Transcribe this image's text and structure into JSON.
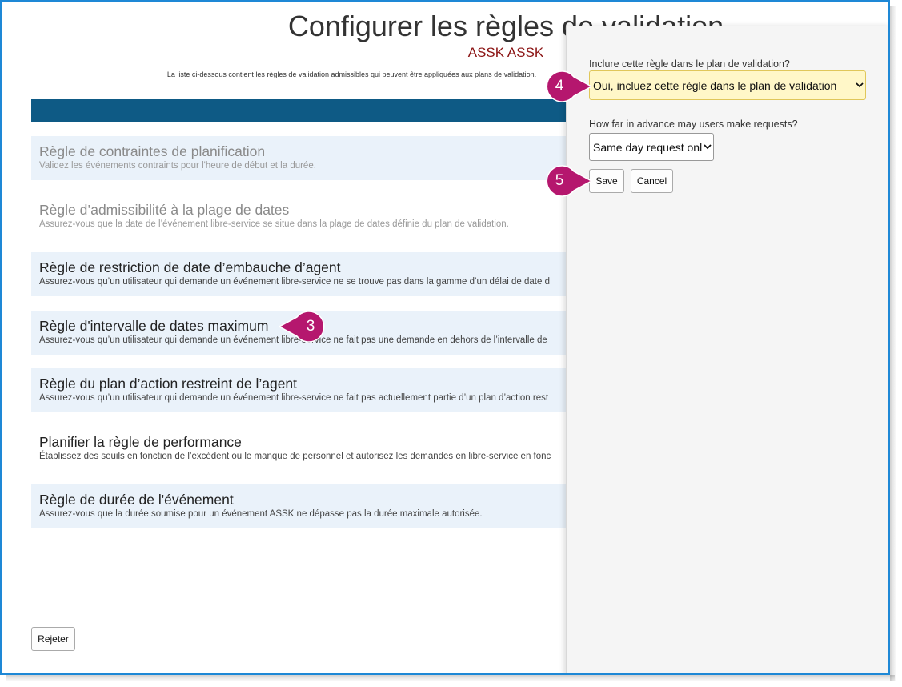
{
  "page": {
    "title": "Configurer les règles de validation",
    "subtitle": "ASSK ASSK",
    "description": "La liste ci-dessous contient les règles de validation admissibles qui peuvent être appliquées aux plans de validation."
  },
  "rules": [
    {
      "title": "Règle de contraintes de planification",
      "description": "Validez les événements contraints pour l'heure de début et la durée."
    },
    {
      "title": "Règle d’admissibilité à la plage de dates",
      "description": "Assurez-vous que la date de l’événement libre-service se situe dans la plage de dates définie du plan de validation."
    },
    {
      "title": "Règle de restriction de date d’embauche d’agent",
      "description": "Assurez-vous qu’un utilisateur qui demande un événement libre-service ne se trouve pas dans la gamme d’un délai de date d"
    },
    {
      "title": "Règle d'intervalle de dates maximum",
      "description": "Assurez-vous qu’un utilisateur qui demande un événement libre-service ne fait pas une demande en dehors de l’intervalle de"
    },
    {
      "title": "Règle du plan d’action restreint de l’agent",
      "description": "Assurez-vous qu’un utilisateur qui demande un événement libre-service ne fait pas actuellement partie d’un plan d’action rest"
    },
    {
      "title": "Planifier la règle de performance",
      "description": "Établissez des seuils en fonction de l’excédent ou le manque de personnel et autorisez les demandes en libre-service en fonc"
    },
    {
      "title": "Règle de durée de l'événement",
      "description": "Assurez-vous que la durée soumise pour un événement ASSK ne dépasse pas la durée maximale autorisée."
    }
  ],
  "reject_label": "Rejeter",
  "panel": {
    "include_label": "Inclure cette règle dans le plan de validation?",
    "include_value": "Oui, incluez cette règle dans le plan de validation",
    "advance_label": "How far in advance may users make requests?",
    "advance_value": "Same day request only",
    "save_label": "Save",
    "cancel_label": "Cancel"
  },
  "callouts": {
    "step3": "3",
    "step4": "4",
    "step5": "5",
    "color": "#b5176e"
  },
  "colors": {
    "header_bar": "#0e5a85",
    "frame_border": "#1e88d6",
    "subtitle": "#8b1414",
    "row_shade": "#eaf2fa",
    "highlight_select": "#fff7c8"
  },
  "icons": {
    "select_arrow": "chevron-down-icon"
  }
}
